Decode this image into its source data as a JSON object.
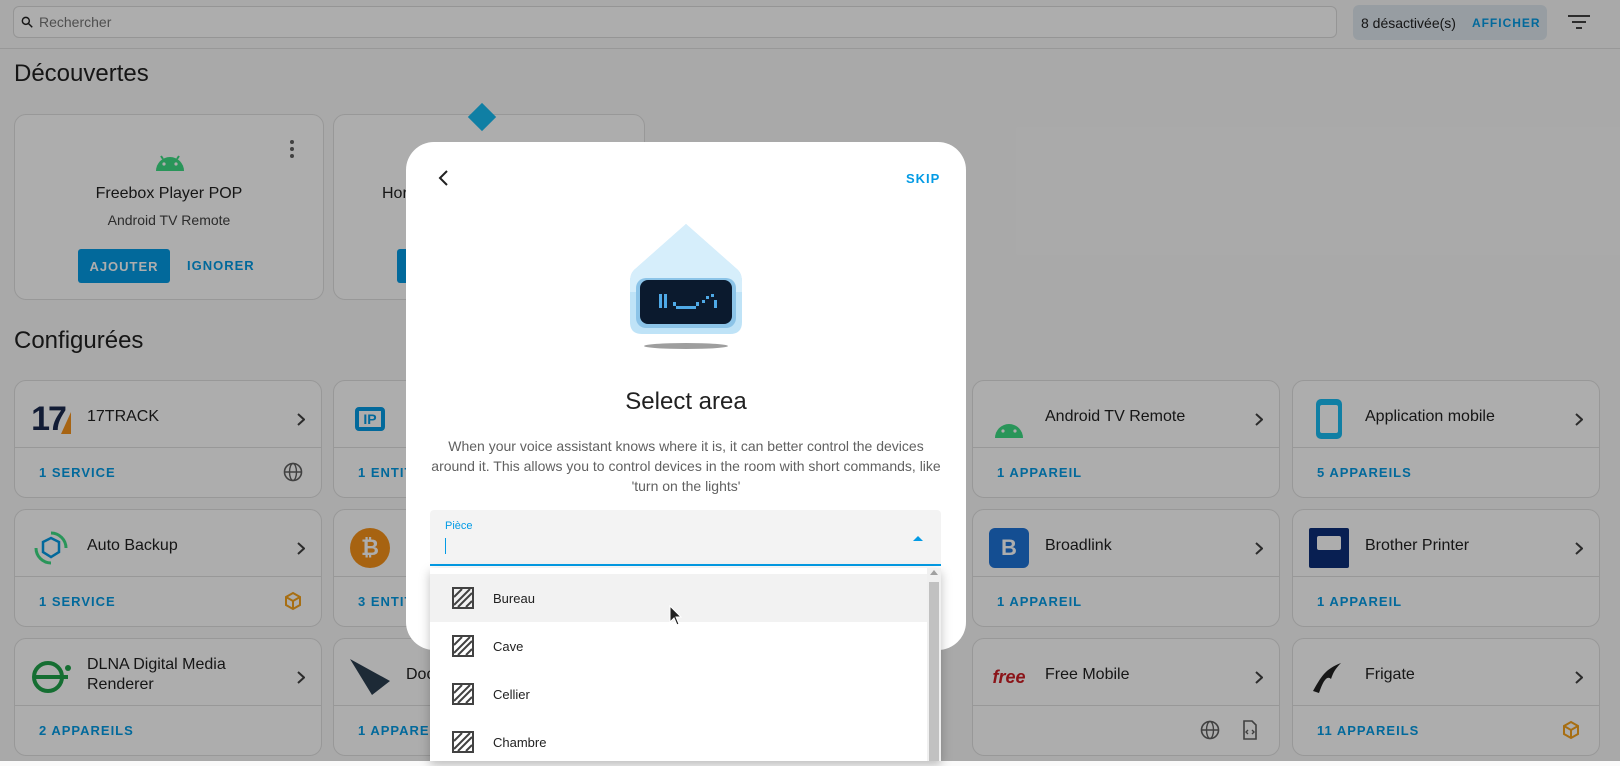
{
  "search": {
    "placeholder": "Rechercher"
  },
  "filters": {
    "disabled_count": "8 désactivée(s)",
    "show_label": "AFFICHER"
  },
  "sections": {
    "discovered": "Découvertes",
    "configured": "Configurées"
  },
  "discovered": [
    {
      "title": "Freebox Player POP",
      "subtitle": "Android TV Remote",
      "add": "AJOUTER",
      "ignore": "IGNORER"
    },
    {
      "title": "Hor"
    }
  ],
  "integrations": [
    {
      "name": "17TRACK",
      "footer": "1 SERVICE",
      "icon": "globe-icon"
    },
    {
      "name": "",
      "footer": "1 ENTIT"
    },
    {
      "name": "Android TV Remote",
      "footer": "1 APPAREIL"
    },
    {
      "name": "Application mobile",
      "footer": "5 APPAREILS"
    },
    {
      "name": "Auto Backup",
      "footer": "1 SERVICE",
      "icon": "custom-integration-icon"
    },
    {
      "name": "",
      "footer": "3 ENTIT"
    },
    {
      "name": "Broadlink",
      "footer": "1 APPAREIL"
    },
    {
      "name": "Brother Printer",
      "footer": "1 APPAREIL"
    },
    {
      "name": "DLNA Digital Media Renderer",
      "footer": "2 APPAREILS"
    },
    {
      "name": "Doc",
      "footer": "1 APPAREI"
    },
    {
      "name": "Free Mobile",
      "footer": ""
    },
    {
      "name": "Frigate",
      "footer": "11 APPAREILS",
      "icon": "custom-integration-icon"
    }
  ],
  "dialog": {
    "skip": "SKIP",
    "title": "Select area",
    "description": "When your voice assistant knows where it is, it can better control the devices around it. This allows you to control devices in the room with short commands, like 'turn on the lights'",
    "field_label": "Pièce",
    "options": [
      "Bureau",
      "Cave",
      "Cellier",
      "Chambre"
    ]
  },
  "colors": {
    "accent": "#039be5",
    "overlay": "rgba(0,0,0,0.32)"
  }
}
